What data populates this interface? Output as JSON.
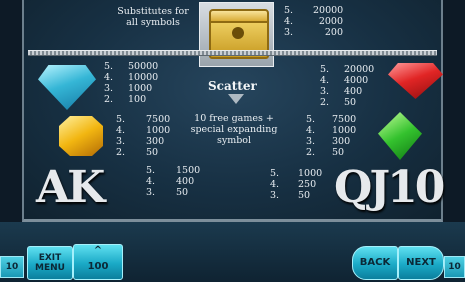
{
  "scatter": {
    "substitutes_text": "Substitutes for all symbols",
    "label": "Scatter",
    "description": "10 free games + special expanding symbol",
    "pays": [
      {
        "count": "5.",
        "value": "20000"
      },
      {
        "count": "4.",
        "value": "2000"
      },
      {
        "count": "3.",
        "value": "200"
      }
    ]
  },
  "blue_gem": {
    "icon": "blue-gem-icon",
    "pays": [
      {
        "count": "5.",
        "value": "50000"
      },
      {
        "count": "4.",
        "value": "10000"
      },
      {
        "count": "3.",
        "value": "1000"
      },
      {
        "count": "2.",
        "value": "100"
      }
    ]
  },
  "red_gem": {
    "icon": "red-gem-icon",
    "pays": [
      {
        "count": "5.",
        "value": "20000"
      },
      {
        "count": "4.",
        "value": "4000"
      },
      {
        "count": "3.",
        "value": "400"
      },
      {
        "count": "2.",
        "value": "50"
      }
    ]
  },
  "yellow_gem": {
    "icon": "yellow-gem-icon",
    "pays": [
      {
        "count": "5.",
        "value": "7500"
      },
      {
        "count": "4.",
        "value": "1000"
      },
      {
        "count": "3.",
        "value": "300"
      },
      {
        "count": "2.",
        "value": "50"
      }
    ]
  },
  "green_gem": {
    "icon": "green-gem-icon",
    "pays": [
      {
        "count": "5.",
        "value": "7500"
      },
      {
        "count": "4.",
        "value": "1000"
      },
      {
        "count": "3.",
        "value": "300"
      },
      {
        "count": "2.",
        "value": "50"
      }
    ]
  },
  "ak": {
    "letters": "AK",
    "pays": [
      {
        "count": "5.",
        "value": "1500"
      },
      {
        "count": "4.",
        "value": "400"
      },
      {
        "count": "3.",
        "value": "50"
      }
    ]
  },
  "qj10": {
    "letters": "QJ10",
    "pays": [
      {
        "count": "5.",
        "value": "1000"
      },
      {
        "count": "4.",
        "value": "250"
      },
      {
        "count": "3.",
        "value": "50"
      }
    ]
  },
  "controls": {
    "lines_value": "10",
    "exit_menu_label": "EXIT MENU",
    "bet_value": "100",
    "up_arrow": "^",
    "back_label": "BACK",
    "next_label": "NEXT",
    "right_value": "10"
  },
  "colors": {
    "panel": "#173043",
    "button": "#1aa9c6",
    "text": "#e9eef2"
  }
}
